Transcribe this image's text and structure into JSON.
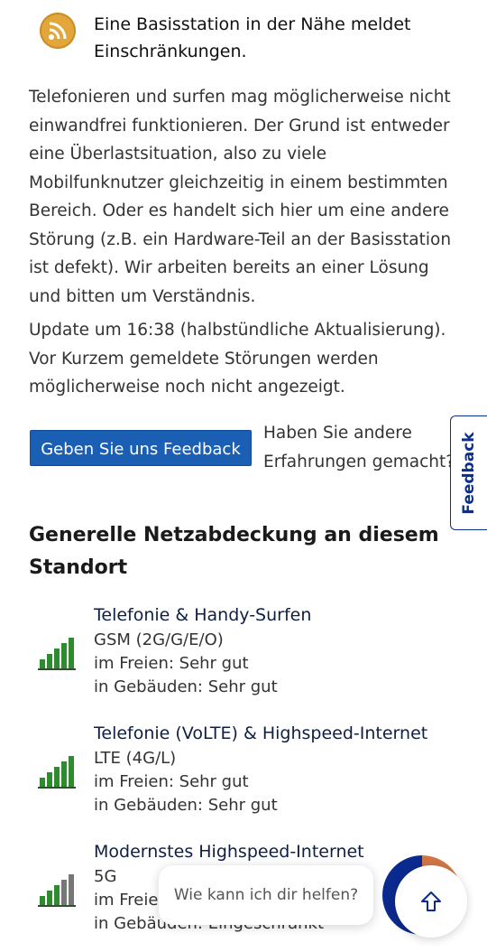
{
  "alert": {
    "icon": "rss-warning-icon",
    "title": "Eine Basisstation in der Nähe meldet Einschränkungen."
  },
  "description": "Telefonieren und surfen mag möglicherweise nicht einwandfrei funktionieren. Der Grund ist entweder eine Überlastsituation, also zu viele Mobilfunknutzer gleichzeitig in einem bestimmten Bereich. Oder es handelt sich hier um eine andere Störung (z.B. ein Hardware-Teil an der Basisstation ist defekt). Wir arbeiten bereits an einer Lösung und bitten um Verständnis.",
  "update_note": "Update um 16:38 (halbstündliche Aktualisierung). Vor Kurzem gemeldete Störungen werden möglicherweise noch nicht angezeigt.",
  "feedback": {
    "button_label": "Geben Sie uns Feedback",
    "note": "Haben Sie andere Erfahrungen gemacht?",
    "side_tab_label": "Feedback"
  },
  "coverage": {
    "heading": "Generelle Netzabdeckung an diesem Standort",
    "items": [
      {
        "title": "Telefonie & Handy-Surfen",
        "tech": "GSM (2G/G/E/O)",
        "outdoor": "im Freien: Sehr gut",
        "indoor": "in Gebäuden: Sehr gut",
        "signal_bars": 5
      },
      {
        "title": "Telefonie (VoLTE) & Highspeed-Internet",
        "tech": "LTE (4G/L)",
        "outdoor": "im Freien: Sehr gut",
        "indoor": "in Gebäuden: Sehr gut",
        "signal_bars": 5
      },
      {
        "title": "Modernstes Highspeed-Internet",
        "tech": "5G",
        "outdoor": "im Freien: Sehr gut",
        "indoor": "in Gebäuden: Eingeschränkt",
        "signal_bars": 3
      }
    ]
  },
  "chat": {
    "prompt": "Wie kann ich dir helfen?",
    "button_icon": "arrow-up-icon"
  },
  "colors": {
    "accent": "#1a5fb4",
    "signal_green": "#2e8b2e",
    "signal_gray": "#777777",
    "warning": "#e3a63a"
  }
}
